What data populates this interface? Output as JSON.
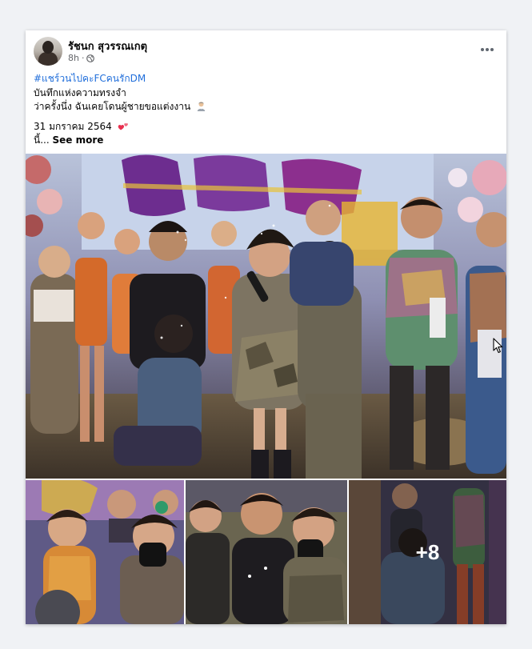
{
  "post": {
    "author": {
      "name": "รัชนก สุวรรณเกตุ"
    },
    "time": "8h",
    "audience_icon": "globe-icon",
    "menu_icon": "more-horizontal-icon",
    "text": {
      "hashtag": "#แชร์วนไปคะFCคนรักDM",
      "line2": "บันทึกแห่งความทรงจำ",
      "line3": "ว่าครั้งนึ่ง ฉันเคยโดนผู้ชายขอแต่งงาน",
      "line3_emoji": "man-emoji",
      "date_line": "31 มกราคม 2564",
      "date_emoji": "two-hearts-emoji",
      "truncated_prefix": "นี้...",
      "see_more": "See more"
    },
    "photos": {
      "main_alt": "stage-proposal-photo",
      "thumbs": [
        "crowd-thumb",
        "couple-thumb",
        "kneeling-thumb"
      ],
      "more_count": "+8"
    }
  },
  "colors": {
    "page_bg": "#f0f2f5",
    "card_bg": "#ffffff",
    "hashtag": "#216fdb",
    "meta": "#65676b",
    "text": "#050505"
  }
}
